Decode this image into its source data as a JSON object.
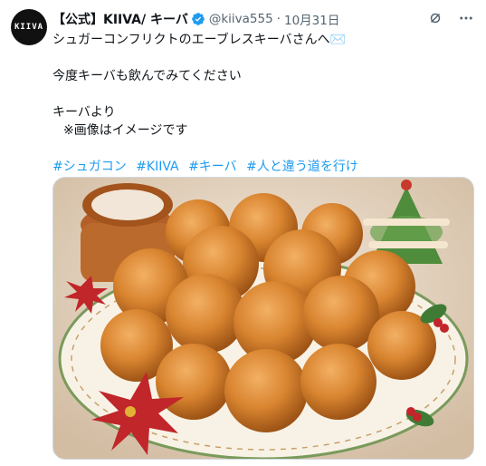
{
  "post": {
    "author_name": "【公式】KIIVA/ キーバ",
    "handle": "@kiiva555",
    "separator": "·",
    "date": "10月31日",
    "avatar_text": "KIIVA",
    "lines": [
      "シュガーコンフリクトのエーブレスキーバさんへ✉️",
      "今度キーバも飲んでみてください",
      "キーバより",
      "※画像はイメージです"
    ],
    "hashtags": [
      "#シュガコン",
      "#KIIVA",
      "#キーバ",
      "#人と違う道を行け"
    ]
  },
  "icons": {
    "verified": "verified-badge-icon",
    "grok": "grok-icon",
    "more": "more-options-icon"
  },
  "colors": {
    "verified": "#1d9bf0",
    "link": "#1d9bf0",
    "secondary_text": "#536471"
  }
}
